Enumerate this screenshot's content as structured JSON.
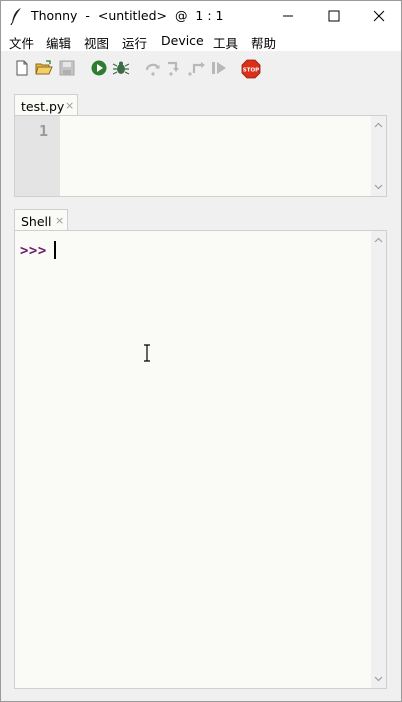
{
  "window": {
    "title": "Thonny  -  <untitled>  @  1 : 1"
  },
  "menu": {
    "items": [
      "文件",
      "编辑",
      "视图",
      "运行",
      "Device",
      "工具",
      "帮助"
    ]
  },
  "toolbar": {
    "buttons": [
      {
        "icon": "new-file-icon",
        "enabled": true
      },
      {
        "icon": "open-folder-icon",
        "enabled": true
      },
      {
        "icon": "save-icon",
        "enabled": false
      },
      {
        "icon": "run-icon",
        "enabled": true
      },
      {
        "icon": "debug-bug-icon",
        "enabled": true
      },
      {
        "icon": "step-over-icon",
        "enabled": false
      },
      {
        "icon": "step-into-icon",
        "enabled": false
      },
      {
        "icon": "step-out-icon",
        "enabled": false
      },
      {
        "icon": "resume-icon",
        "enabled": false
      },
      {
        "icon": "stop-icon",
        "enabled": true,
        "label": "STOP"
      }
    ]
  },
  "editor": {
    "tab_label": "test.py",
    "close_glyph": "×",
    "line_numbers": [
      "1"
    ]
  },
  "shell": {
    "tab_label": "Shell",
    "close_glyph": "×",
    "prompt": ">>>"
  },
  "colors": {
    "prompt": "#6a1b6a",
    "run_green": "#2e7d32",
    "stop_red": "#d9301c",
    "disabled": "#b8b8b8"
  }
}
